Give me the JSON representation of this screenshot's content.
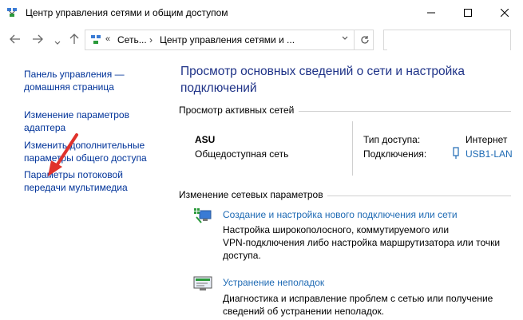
{
  "window": {
    "title": "Центр управления сетями и общим доступом",
    "minimize_icon": "minimize-icon",
    "maximize_icon": "maximize-icon",
    "close_icon": "close-icon"
  },
  "nav": {
    "address_root": "Сеть...",
    "address_current": "Центр управления сетями и ...",
    "search_placeholder": ""
  },
  "sidebar": {
    "items": [
      {
        "label_line1": "Панель управления —",
        "label_line2": "домашняя страница"
      },
      {
        "label_line1": "Изменение параметров",
        "label_line2": "адаптера"
      },
      {
        "label_line1": "Изменить дополнительные",
        "label_line2": "параметры общего доступа"
      },
      {
        "label_line1": "Параметры потоковой",
        "label_line2": "передачи мультимедиа"
      }
    ]
  },
  "main": {
    "title_line1": "Просмотр основных сведений о сети и настройка",
    "title_line2": "подключений",
    "active_networks_heading": "Просмотр активных сетей",
    "network": {
      "name": "ASU",
      "category": "Общедоступная сеть",
      "access_type_label": "Тип доступа:",
      "access_type_value": "Интернет",
      "connections_label": "Подключения:",
      "connections_value": "USB1-LAN"
    },
    "change_settings_heading": "Изменение сетевых параметров",
    "tasks": [
      {
        "link": "Создание и настройка нового подключения или сети",
        "desc_line1": "Настройка широкополосного, коммутируемого или",
        "desc_line2": "VPN-подключения либо настройка маршрутизатора или точки",
        "desc_line3": "доступа."
      },
      {
        "link": "Устранение неполадок",
        "desc_line1": "Диагностика и исправление проблем с сетью или получение",
        "desc_line2": "сведений об устранении неполадок."
      }
    ]
  },
  "colors": {
    "link": "#003399",
    "title": "#1e3287",
    "task_link": "#1e6ab4",
    "arrow": "#e0322b"
  }
}
